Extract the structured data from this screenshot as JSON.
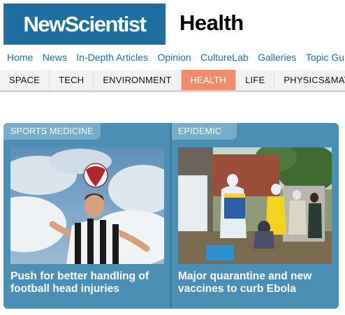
{
  "header": {
    "logo_text": "NewScientist",
    "section_title": "Health"
  },
  "topnav": {
    "items": [
      "Home",
      "News",
      "In-Depth Articles",
      "Opinion",
      "CultureLab",
      "Galleries",
      "Topic Guides"
    ]
  },
  "tabs": {
    "items": [
      "SPACE",
      "TECH",
      "ENVIRONMENT",
      "HEALTH",
      "LIFE",
      "PHYSICS&MATH"
    ],
    "active": "HEALTH"
  },
  "cards": [
    {
      "category": "SPORTS MEDICINE",
      "headline": "Push for better handling of football head injuries",
      "image": "footballer-heading-ball-photo"
    },
    {
      "category": "EPIDEMIC",
      "headline": "Major quarantine and new vaccines to curb Ebola",
      "image": "ebola-health-workers-photo"
    }
  ],
  "colors": {
    "logo_bg": "#1e6fa0",
    "nav_link": "#1c6ea4",
    "active_tab": "#f08c6c",
    "panel_bg": "#4b8fb5",
    "badge_bg": "#78acc8"
  }
}
